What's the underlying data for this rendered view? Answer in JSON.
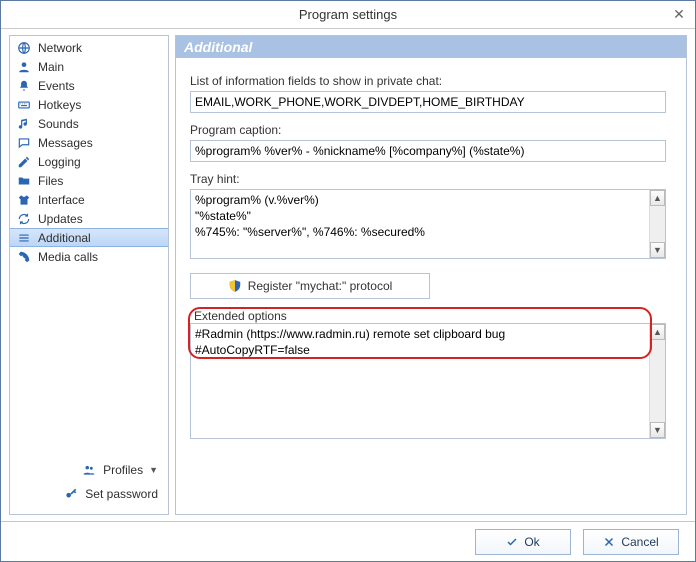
{
  "window": {
    "title": "Program settings"
  },
  "sidebar": {
    "items": [
      {
        "label": "Network"
      },
      {
        "label": "Main"
      },
      {
        "label": "Events"
      },
      {
        "label": "Hotkeys"
      },
      {
        "label": "Sounds"
      },
      {
        "label": "Messages"
      },
      {
        "label": "Logging"
      },
      {
        "label": "Files"
      },
      {
        "label": "Interface"
      },
      {
        "label": "Updates"
      },
      {
        "label": "Additional"
      },
      {
        "label": "Media calls"
      }
    ],
    "actions": {
      "profiles": "Profiles",
      "set_password": "Set password"
    }
  },
  "panel": {
    "title": "Additional",
    "fields_label": "List of information fields to show in private chat:",
    "fields_value": "EMAIL,WORK_PHONE,WORK_DIVDEPT,HOME_BIRTHDAY",
    "caption_label": "Program caption:",
    "caption_value": "%program% %ver% - %nickname% [%company%] (%state%)",
    "tray_label": "Tray hint:",
    "tray_value": "%program% (v.%ver%)\n\"%state%\"\n%745%: \"%server%\", %746%: %secured%",
    "register_label": "Register \"mychat:\" protocol",
    "ext_label": "Extended options",
    "ext_value": "#Radmin (https://www.radmin.ru) remote set clipboard bug\n#AutoCopyRTF=false"
  },
  "footer": {
    "ok": "Ok",
    "cancel": "Cancel"
  }
}
